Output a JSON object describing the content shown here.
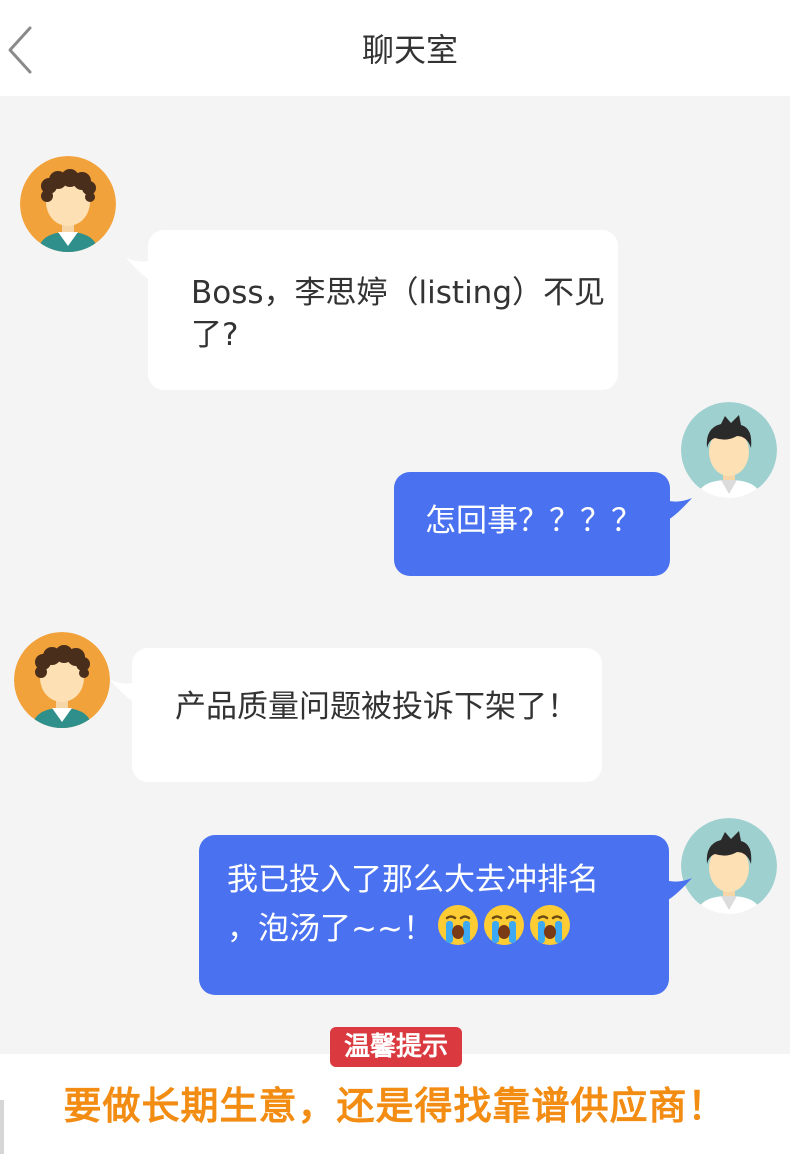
{
  "header": {
    "title": "聊天室",
    "back_icon": "chevron-left-icon"
  },
  "messages": [
    {
      "side": "in",
      "text_line1": "Boss，李思婷（listing）不见",
      "text_line2": "了?"
    },
    {
      "side": "out",
      "text": "怎回事？？？？"
    },
    {
      "side": "in",
      "text": "产品质量问题被投诉下架了！"
    },
    {
      "side": "out",
      "text_line1": "我已投入了那么大去冲排名",
      "text_line2": "，泡汤了~~！",
      "emojis": [
        "crying-face-icon",
        "crying-face-icon",
        "crying-face-icon"
      ]
    }
  ],
  "footer": {
    "tip_label": "温馨提示",
    "slogan": "要做长期生意，还是得找靠谱供应商！"
  },
  "colors": {
    "outgoing_bubble": "#4a72f0",
    "incoming_bubble": "#ffffff",
    "chat_background": "#f4f4f4",
    "tip_badge": "#d9393f",
    "slogan_text": "#f28c12"
  }
}
